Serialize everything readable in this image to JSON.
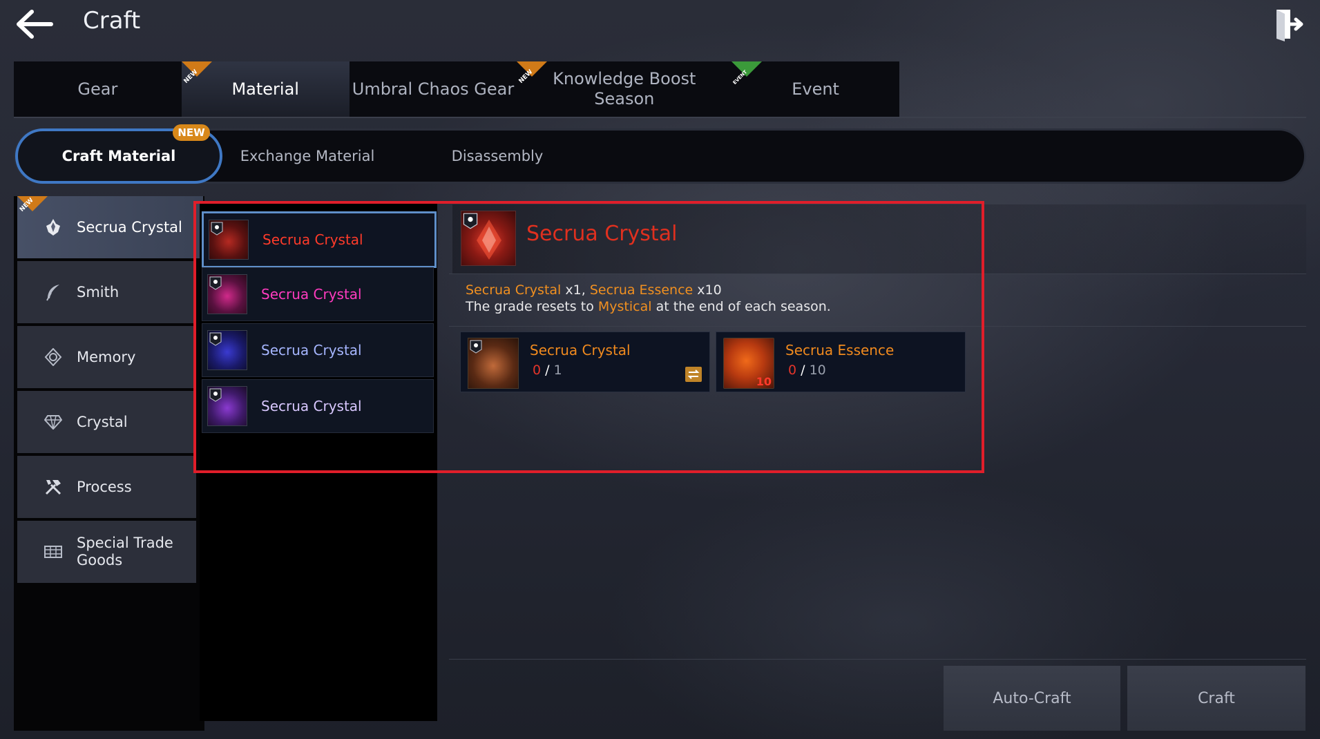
{
  "header": {
    "title": "Craft"
  },
  "top_tabs": [
    {
      "label": "Gear",
      "badge": ""
    },
    {
      "label": "Material",
      "badge": "NEW"
    },
    {
      "label": "Umbral Chaos Gear",
      "badge": ""
    },
    {
      "label": "Knowledge Boost Season",
      "badge": "NEW"
    },
    {
      "label": "Event",
      "badge": "EVENT"
    }
  ],
  "sub_tabs": [
    {
      "label": "Craft Material",
      "badge": "NEW"
    },
    {
      "label": "Exchange Material"
    },
    {
      "label": "Disassembly"
    }
  ],
  "categories": [
    {
      "label": "Secrua Crystal",
      "icon": "crystal-cluster-icon",
      "badge": "NEW"
    },
    {
      "label": "Smith",
      "icon": "feather-icon"
    },
    {
      "label": "Memory",
      "icon": "memory-icon"
    },
    {
      "label": "Crystal",
      "icon": "diamond-icon"
    },
    {
      "label": "Process",
      "icon": "tools-icon"
    },
    {
      "label": "Special Trade Goods",
      "icon": "trade-goods-icon"
    }
  ],
  "items": [
    {
      "name": "Secrua Crystal",
      "color": "#ff3b2a"
    },
    {
      "name": "Secrua Crystal",
      "color": "#ff3bbf"
    },
    {
      "name": "Secrua Crystal",
      "color": "#a6b6ff"
    },
    {
      "name": "Secrua Crystal",
      "color": "#d9c8ff"
    }
  ],
  "detail": {
    "title": "Secrua Crystal",
    "recipe": {
      "item1": "Secrua Crystal",
      "qty1": "x1",
      "sep": ",",
      "item2": "Secrua Essence",
      "qty2": "x10"
    },
    "desc": {
      "pre": "The grade resets to",
      "grade": "Mystical",
      "post": "at the end of each season."
    },
    "materials": [
      {
        "name": "Secrua Crystal",
        "have": "0",
        "sep": "/",
        "need": "1",
        "qty_badge": ""
      },
      {
        "name": "Secrua Essence",
        "have": "0",
        "sep": "/",
        "need": "10",
        "qty_badge": "10"
      }
    ]
  },
  "buttons": {
    "auto_craft": "Auto-Craft",
    "craft": "Craft"
  },
  "colors": {
    "accent_blue": "#3f78c4",
    "highlight_red": "#e01e2a",
    "title_red": "#e0301f",
    "orange": "#f19020"
  }
}
